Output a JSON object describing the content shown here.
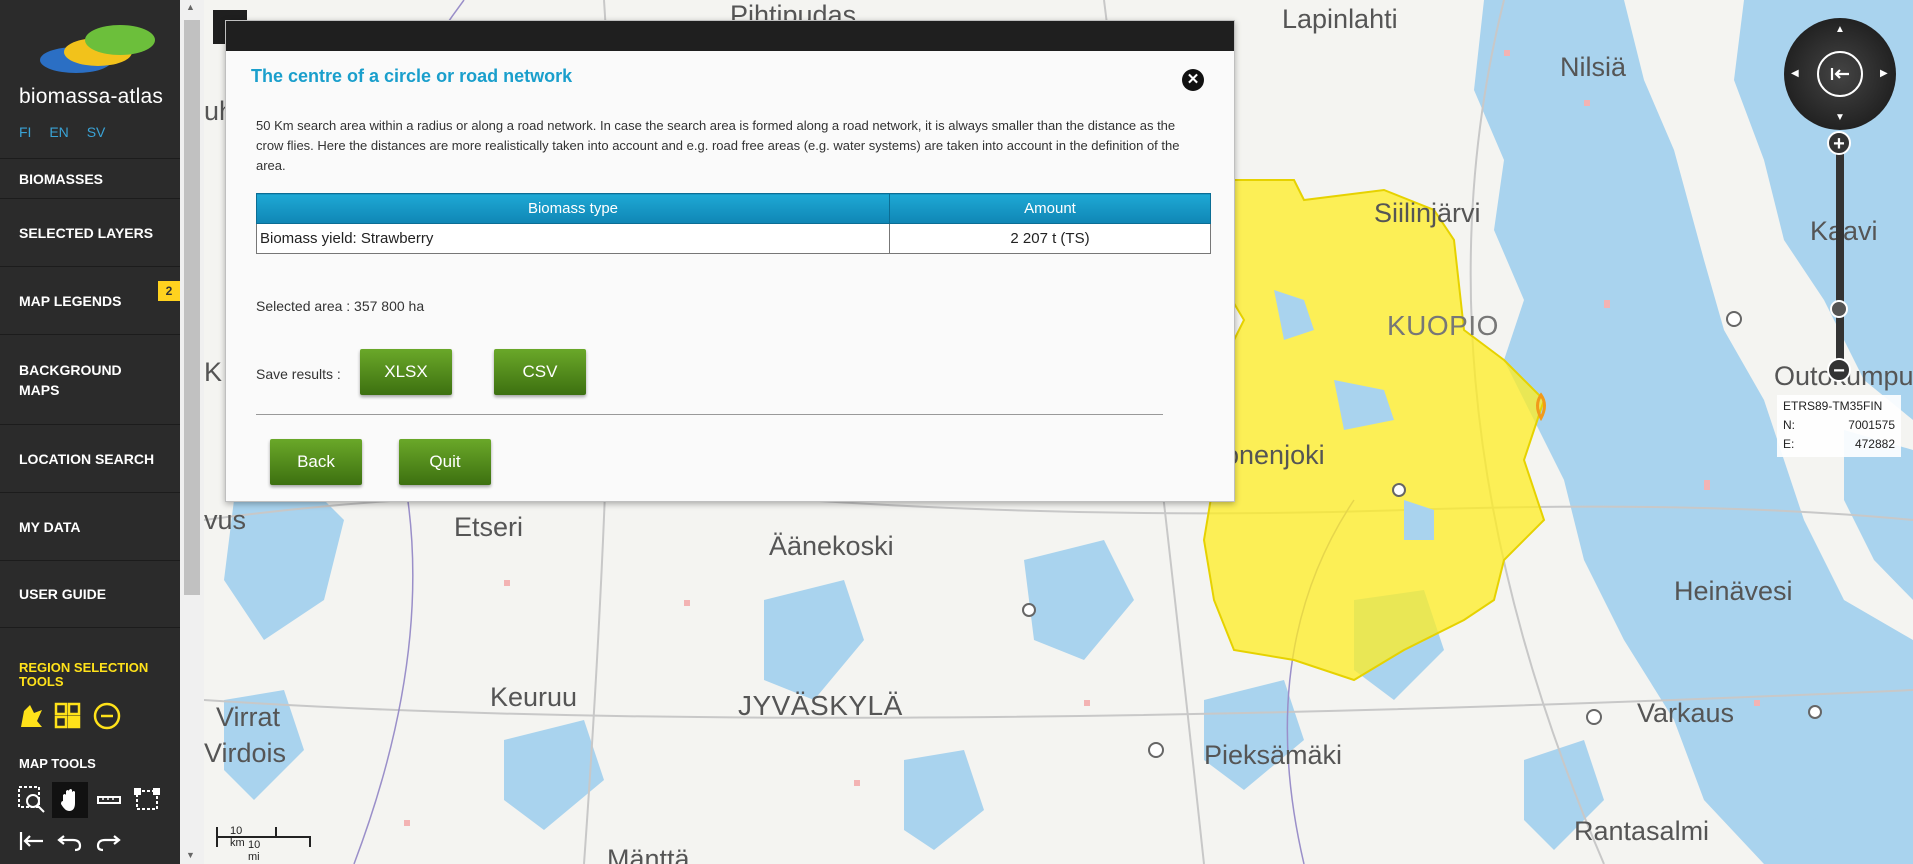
{
  "app": {
    "name": "biomassa-atlas"
  },
  "languages": [
    "FI",
    "EN",
    "SV"
  ],
  "menu": [
    {
      "label": "BIOMASSES"
    },
    {
      "label": "SELECTED LAYERS"
    },
    {
      "label": "MAP LEGENDS",
      "badge": "2"
    },
    {
      "label": "BACKGROUND MAPS"
    },
    {
      "label": "LOCATION SEARCH"
    },
    {
      "label": "MY DATA"
    },
    {
      "label": "USER GUIDE"
    }
  ],
  "region_tools": {
    "title": "REGION SELECTION TOOLS",
    "icons": [
      "polygon-select-icon",
      "grid-select-icon",
      "circle-select-icon"
    ]
  },
  "map_tools": {
    "title": "MAP TOOLS",
    "icons": [
      "zoom-box-icon",
      "pan-hand-icon",
      "measure-icon",
      "select-area-icon",
      "home-extent-icon",
      "undo-icon",
      "redo-icon"
    ]
  },
  "dialog": {
    "title": "The centre of a circle or road network",
    "description": "50 Km search area within a radius or along a road network. In case the search area is formed along a road network, it is always smaller than the distance as the crow flies. Here the distances are more realistically taken into account and e.g. road free areas (e.g. water systems) are taken into account in the definition of the area.",
    "table": {
      "headers": [
        "Biomass type",
        "Amount"
      ],
      "rows": [
        [
          "Biomass yield: Strawberry",
          "2 207  t (TS)"
        ]
      ]
    },
    "selected_area": "Selected area : 357 800 ha",
    "save_label": "Save results :",
    "buttons": {
      "xlsx": "XLSX",
      "csv": "CSV",
      "back": "Back",
      "quit": "Quit"
    },
    "close_symbol": "✕"
  },
  "map": {
    "places": [
      "Pihtipudas",
      "Lapinlahti",
      "Nilsiä",
      "Siilinjärvi",
      "Kaavi",
      "KUOPIO",
      "Outokumpu",
      "vus",
      "Etseri",
      "Äänekoski",
      "onenjoki",
      "Heinävesi",
      "Keuruu",
      "JYVÄSKYLÄ",
      "Virrat",
      "Virdois",
      "Pieksämäki",
      "Varkaus",
      "Mänttä",
      "Rantasalmi",
      "uh",
      "K"
    ],
    "colors": {
      "water": "#a9d3ee",
      "land": "#f4f4f1",
      "selection": "#ffee22",
      "accent": "#1a9fcc",
      "button": "#4e8a18"
    }
  },
  "coords": {
    "crs": "ETRS89-TM35FIN",
    "n_label": "N:",
    "n_value": "7001575",
    "e_label": "E:",
    "e_value": "472882"
  },
  "scale": {
    "km": "10 km",
    "mi": "10 mi"
  }
}
